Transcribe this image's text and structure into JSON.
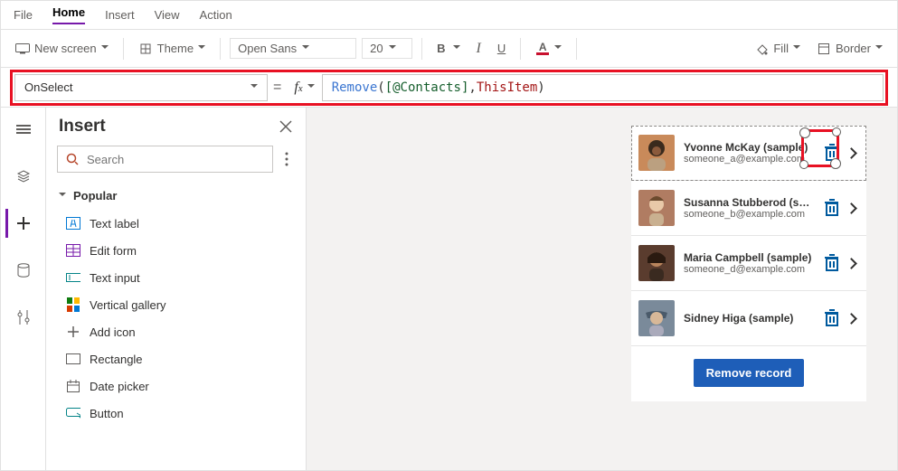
{
  "menubar": {
    "items": [
      "File",
      "Home",
      "Insert",
      "View",
      "Action"
    ],
    "activeIndex": 1
  },
  "ribbon": {
    "newScreen": "New screen",
    "theme": "Theme",
    "font": "Open Sans",
    "fontSize": "20",
    "bold": "B",
    "italic": "I",
    "underline": "U",
    "fill": "Fill",
    "border": "Border"
  },
  "formula": {
    "property": "OnSelect",
    "fn": "Remove",
    "open": "( ",
    "arg1": "[@Contacts]",
    "comma": ", ",
    "arg2": "ThisItem",
    "close": " )"
  },
  "panel": {
    "title": "Insert",
    "searchPlaceholder": "Search",
    "section": "Popular",
    "items": [
      "Text label",
      "Edit form",
      "Text input",
      "Vertical gallery",
      "Add icon",
      "Rectangle",
      "Date picker",
      "Button"
    ]
  },
  "gallery": {
    "rows": [
      {
        "name": "Yvonne McKay (sample)",
        "email": "someone_a@example.com",
        "avatar_bg": "#c98a5a",
        "selected": true
      },
      {
        "name": "Susanna Stubberod (sample)",
        "email": "someone_b@example.com",
        "avatar_bg": "#b07c62"
      },
      {
        "name": "Maria Campbell (sample)",
        "email": "someone_d@example.com",
        "avatar_bg": "#5a3c2e"
      },
      {
        "name": "Sidney Higa (sample)",
        "email": "",
        "avatar_bg": "#7a8a9a"
      }
    ],
    "button": "Remove record"
  }
}
